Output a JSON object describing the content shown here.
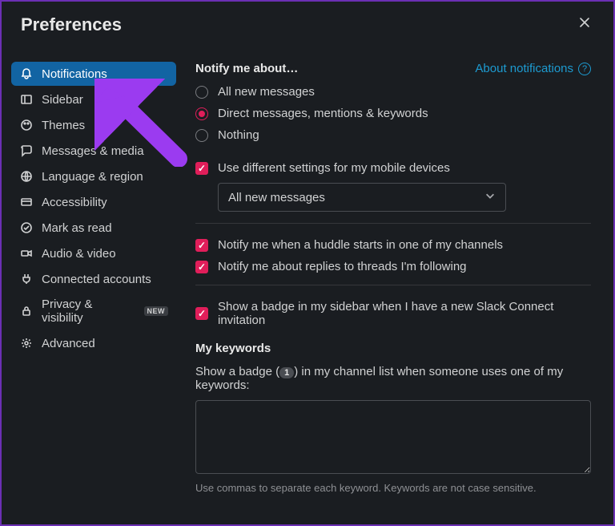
{
  "header": {
    "title": "Preferences"
  },
  "sidebar": {
    "items": [
      {
        "label": "Notifications",
        "active": true,
        "icon": "bell"
      },
      {
        "label": "Sidebar",
        "icon": "sidebar"
      },
      {
        "label": "Themes",
        "icon": "palette"
      },
      {
        "label": "Messages & media",
        "icon": "chat"
      },
      {
        "label": "Language & region",
        "icon": "globe"
      },
      {
        "label": "Accessibility",
        "icon": "accessibility"
      },
      {
        "label": "Mark as read",
        "icon": "check-circle"
      },
      {
        "label": "Audio & video",
        "icon": "video"
      },
      {
        "label": "Connected accounts",
        "icon": "plug"
      },
      {
        "label": "Privacy & visibility",
        "icon": "lock",
        "badge": "NEW"
      },
      {
        "label": "Advanced",
        "icon": "gear"
      }
    ]
  },
  "content": {
    "notify_heading": "Notify me about…",
    "help_link": "About notifications",
    "radios": [
      {
        "label": "All new messages",
        "selected": false
      },
      {
        "label": "Direct messages, mentions & keywords",
        "selected": true
      },
      {
        "label": "Nothing",
        "selected": false
      }
    ],
    "mobile_diff": {
      "label": "Use different settings for my mobile devices",
      "checked": true
    },
    "mobile_select": {
      "value": "All new messages"
    },
    "huddle": {
      "label": "Notify me when a huddle starts in one of my channels",
      "checked": true
    },
    "threads": {
      "label": "Notify me about replies to threads I'm following",
      "checked": true
    },
    "connect_badge": {
      "label": "Show a badge in my sidebar when I have a new Slack Connect invitation",
      "checked": true
    },
    "keywords": {
      "heading": "My keywords",
      "desc_pre": "Show a badge (",
      "desc_badge": "1",
      "desc_post": ") in my channel list when someone uses one of my keywords:",
      "value": "",
      "hint": "Use commas to separate each keyword. Keywords are not case sensitive."
    }
  }
}
